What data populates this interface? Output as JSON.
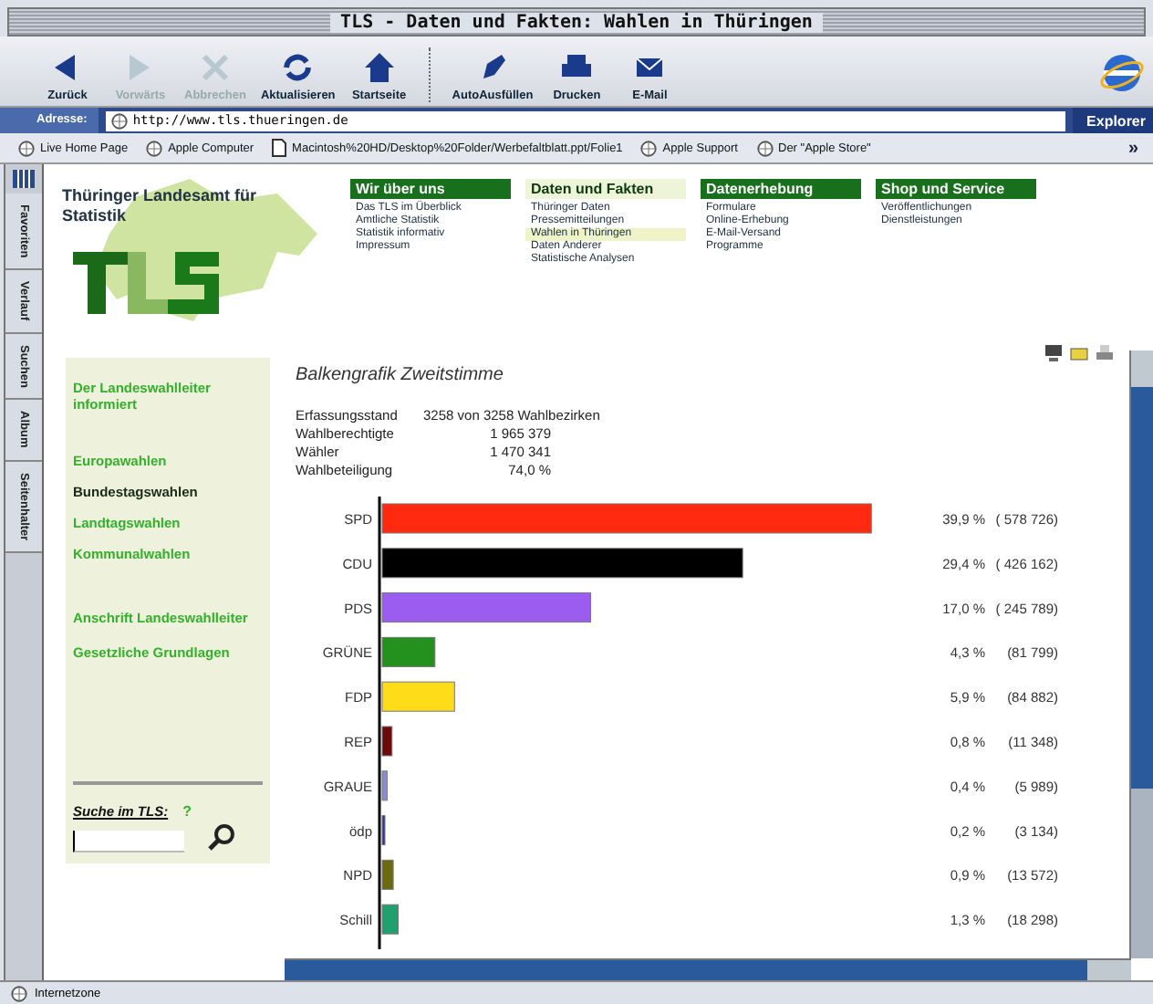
{
  "window": {
    "title": "TLS - Daten und Fakten: Wahlen in Thüringen"
  },
  "toolbar": [
    {
      "label": "Zurück",
      "kind": "back",
      "disabled": false
    },
    {
      "label": "Vorwärts",
      "kind": "forward",
      "disabled": true
    },
    {
      "label": "Abbrechen",
      "kind": "stop",
      "disabled": true
    },
    {
      "label": "Aktualisieren",
      "kind": "refresh",
      "disabled": false
    },
    {
      "label": "Startseite",
      "kind": "home",
      "disabled": false
    },
    {
      "label": "AutoAusfüllen",
      "kind": "autofill",
      "disabled": false
    },
    {
      "label": "Drucken",
      "kind": "print",
      "disabled": false
    },
    {
      "label": "E-Mail",
      "kind": "mail",
      "disabled": false
    }
  ],
  "address_bar": {
    "label": "Adresse:",
    "value": "http://www.tls.thueringen.de",
    "go_button": "Explorer"
  },
  "favorites": [
    {
      "label": "Live Home Page",
      "kind": "site"
    },
    {
      "label": "Apple Computer",
      "kind": "site"
    },
    {
      "label": "Macintosh%20HD/Desktop%20Folder/Werbefaltblatt.ppt/Folie1",
      "kind": "file"
    },
    {
      "label": "Apple Support",
      "kind": "site"
    },
    {
      "label": "Der \"Apple Store\"",
      "kind": "site"
    }
  ],
  "favorites_more": "»",
  "side_tabs": [
    "Favoriten",
    "Verlauf",
    "Suchen",
    "Album",
    "Seitenhalter"
  ],
  "site": {
    "name": "Thüringer Landesamt für Statistik",
    "nav": [
      {
        "heading": "Wir über uns",
        "selected": false,
        "items": [
          {
            "label": "Das TLS im Überblick",
            "selected": false
          },
          {
            "label": "Amtliche Statistik",
            "selected": false
          },
          {
            "label": "Statistik informativ",
            "selected": false
          },
          {
            "label": "Impressum",
            "selected": false
          }
        ]
      },
      {
        "heading": "Daten und Fakten",
        "selected": true,
        "items": [
          {
            "label": "Thüringer Daten",
            "selected": false
          },
          {
            "label": "Pressemitteilungen",
            "selected": false
          },
          {
            "label": "Wahlen in Thüringen",
            "selected": true
          },
          {
            "label": "Daten Anderer",
            "selected": false
          },
          {
            "label": "Statistische Analysen",
            "selected": false
          }
        ]
      },
      {
        "heading": "Datenerhebung",
        "selected": false,
        "items": [
          {
            "label": "Formulare",
            "selected": false
          },
          {
            "label": "Online-Erhebung",
            "selected": false
          },
          {
            "label": "E-Mail-Versand",
            "selected": false
          },
          {
            "label": "Programme",
            "selected": false
          }
        ]
      },
      {
        "heading": "Shop und Service",
        "selected": false,
        "items": [
          {
            "label": "Veröffentlichungen",
            "selected": false
          },
          {
            "label": "Dienstleistungen",
            "selected": false
          }
        ]
      }
    ],
    "sidebar": [
      {
        "label": "Der Landeswahlleiter informiert",
        "selected": false
      },
      {
        "label": "Europawahlen",
        "selected": false
      },
      {
        "label": "Bundestagswahlen",
        "selected": true
      },
      {
        "label": "Landtagswahlen",
        "selected": false
      },
      {
        "label": "Kommunalwahlen",
        "selected": false
      },
      {
        "label": "Anschrift Landeswahlleiter",
        "selected": false
      },
      {
        "label": "Gesetzliche Grundlagen",
        "selected": false
      }
    ],
    "search": {
      "label": "Suche im TLS:",
      "help": "?"
    }
  },
  "results": {
    "title": "Balkengrafik Zweitstimme",
    "stats": [
      {
        "label": "Erfassungsstand",
        "value": "3258 von 3258 Wahlbezirken"
      },
      {
        "label": "Wahlberechtigte",
        "value": "1 965 379"
      },
      {
        "label": "Wähler",
        "value": "1 470 341"
      },
      {
        "label": "Wahlbeteiligung",
        "value": "74,0 %"
      }
    ],
    "chart_data": {
      "type": "bar",
      "orientation": "horizontal",
      "categories": [
        "SPD",
        "CDU",
        "PDS",
        "GRÜNE",
        "FDP",
        "REP",
        "GRAUE",
        "ödp",
        "NPD",
        "Schill"
      ],
      "values": [
        39.9,
        29.4,
        17.0,
        4.3,
        5.9,
        0.8,
        0.4,
        0.2,
        0.9,
        1.3
      ],
      "colors": [
        "#ff2a10",
        "#000000",
        "#9b5cf0",
        "#24901e",
        "#ffdc1a",
        "#6a0a0a",
        "#8a8ad8",
        "#3030a0",
        "#6a6a10",
        "#20a070"
      ],
      "value_labels": [
        "39,9 %",
        "29,4 %",
        "17,0 %",
        "4,3 %",
        "5,9 %",
        "0,8 %",
        "0,4 %",
        "0,2 %",
        "0,9 %",
        "1,3 %"
      ]
    },
    "vote_counts": [
      "( 578 726)",
      "( 426 162)",
      "( 245 789)",
      "(81 799)",
      "(84 882)",
      "(11 348)",
      "(5 989)",
      "(3 134)",
      "(13 572)",
      "(18 298)"
    ]
  },
  "status_bar": {
    "zone": "Internetzone"
  }
}
